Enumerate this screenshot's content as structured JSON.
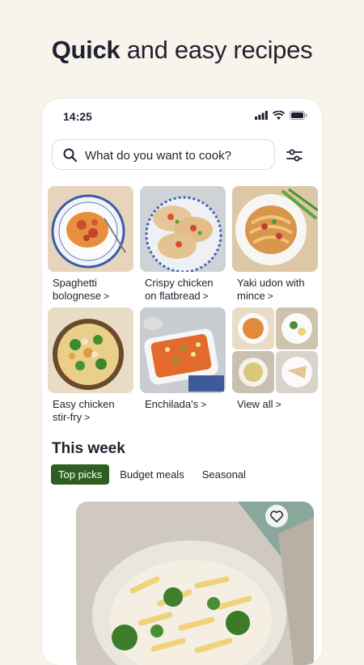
{
  "headline": {
    "bold": "Quick",
    "rest": " and easy recipes"
  },
  "status": {
    "time": "14:25"
  },
  "search": {
    "placeholder": "What do you want to cook?"
  },
  "tiles": [
    {
      "label": "Spaghetti bolognese"
    },
    {
      "label": "Crispy chicken on flatbread"
    },
    {
      "label": "Yaki udon with mince"
    },
    {
      "label": "Easy chicken stir-fry"
    },
    {
      "label": "Enchilada's"
    },
    {
      "label": "View all"
    }
  ],
  "section": {
    "title": "This week"
  },
  "chips": [
    {
      "label": "Top picks",
      "active": true
    },
    {
      "label": "Budget meals",
      "active": false
    },
    {
      "label": "Seasonal",
      "active": false
    }
  ],
  "colors": {
    "brand_green": "#2e5e20",
    "background": "#f8f4ec"
  }
}
